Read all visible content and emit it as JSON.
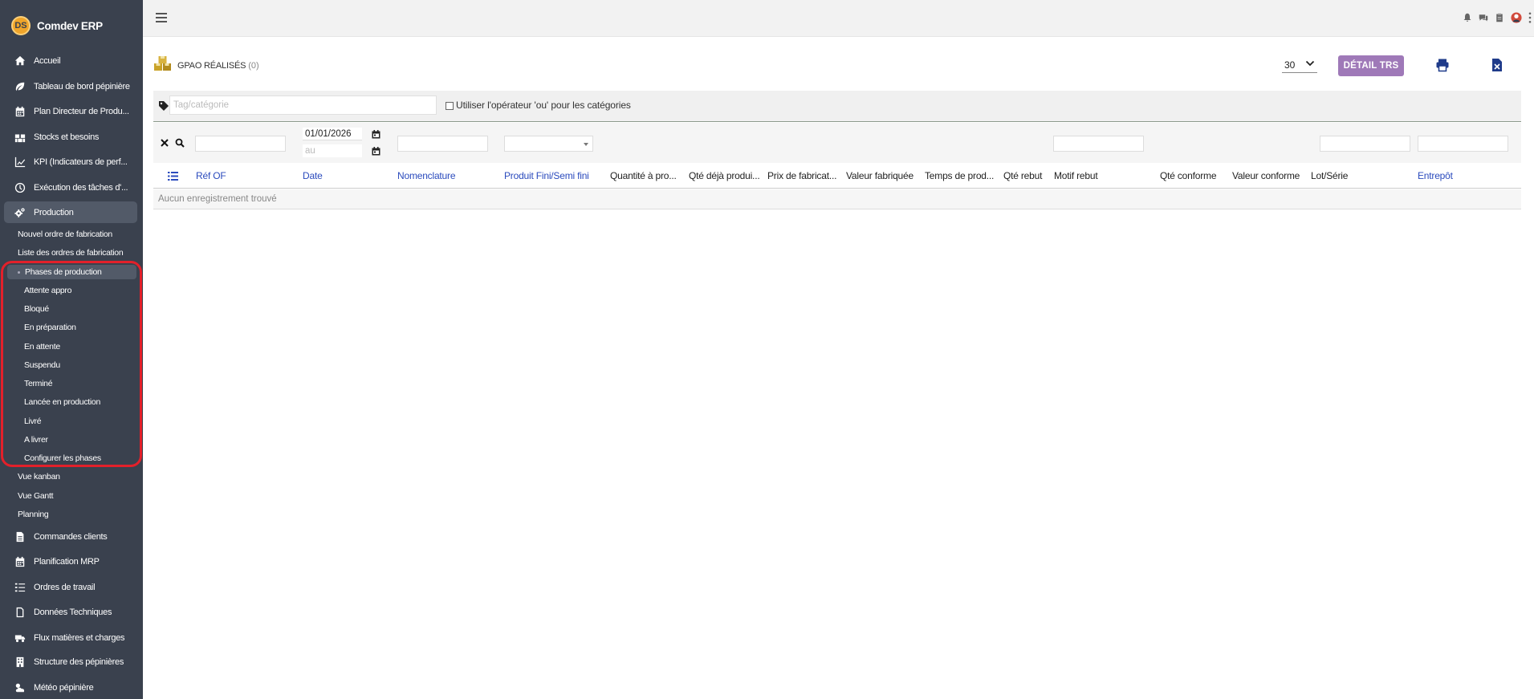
{
  "app": {
    "name": "Comdev ERP",
    "logo_text": "DS"
  },
  "sidebar": {
    "items": [
      {
        "label": "Accueil",
        "icon": "home-icon"
      },
      {
        "label": "Tableau de bord pépinière",
        "icon": "leaf-icon"
      },
      {
        "label": "Plan Directeur de Produ...",
        "icon": "calendar-icon"
      },
      {
        "label": "Stocks et besoins",
        "icon": "boxes-icon"
      },
      {
        "label": "KPI (Indicateurs de perf...",
        "icon": "chart-line-icon"
      },
      {
        "label": "Exécution des tâches d'...",
        "icon": "clock-icon"
      },
      {
        "label": "Production",
        "icon": "gears-icon"
      }
    ],
    "production_sub": [
      "Nouvel ordre de fabrication",
      "Liste des ordres de fabrication"
    ],
    "phases_head": "Phases de production",
    "phases": [
      "Attente appro",
      "Bloqué",
      "En préparation",
      "En attente",
      "Suspendu",
      "Terminé",
      "Lancée en production",
      "Livré",
      "A livrer",
      "Configurer les phases"
    ],
    "production_sub2": [
      "Vue kanban",
      "Vue Gantt",
      "Planning"
    ],
    "items_after": [
      {
        "label": "Commandes clients",
        "icon": "file-icon"
      },
      {
        "label": "Planification MRP",
        "icon": "calendar-icon"
      },
      {
        "label": "Ordres de travail",
        "icon": "list-check-icon"
      },
      {
        "label": "Données Techniques",
        "icon": "document-icon"
      },
      {
        "label": "Flux matières et charges",
        "icon": "truck-boxes-icon"
      },
      {
        "label": "Structure des pépinières",
        "icon": "building-icon"
      },
      {
        "label": "Météo pépinière",
        "icon": "cloud-sun-icon"
      }
    ]
  },
  "header": {
    "title": "GPAO RÉALISÉS",
    "count": "(0)",
    "per_page": "30",
    "detail_button": "DÉTAIL TRS"
  },
  "tagbar": {
    "placeholder": "Tag/catégorie",
    "or_label": "Utiliser l'opérateur 'ou' pour les catégories"
  },
  "filters": {
    "date_from": "01/01/2026",
    "date_to_placeholder": "au"
  },
  "table": {
    "columns": [
      "Réf OF",
      "Date",
      "Nomenclature",
      "Produit Fini/Semi fini",
      "Quantité à pro...",
      "Qté déjà produi...",
      "Prix de fabricat...",
      "Valeur fabriquée",
      "Temps de prod...",
      "Qté rebut",
      "Motif rebut",
      "Qté conforme",
      "Valeur conforme",
      "Lot/Série",
      "Entrepôt"
    ],
    "empty_text": "Aucun enregistrement trouvé"
  },
  "colors": {
    "sidebar_bg": "#3a414e",
    "active_bg": "#525a68",
    "accent_button": "#9f79b8",
    "highlight_border": "#e3202a",
    "link": "#2b4bbd"
  }
}
